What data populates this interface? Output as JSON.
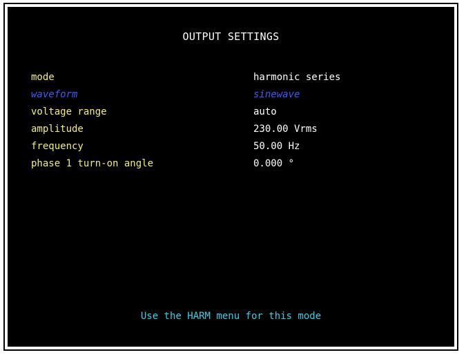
{
  "screen": {
    "title": "OUTPUT SETTINGS",
    "footer_hint": "Use the HARM menu for this mode"
  },
  "settings": [
    {
      "label": "mode",
      "value": "harmonic series",
      "selected": false
    },
    {
      "label": "waveform",
      "value": "sinewave",
      "selected": true
    },
    {
      "label": "voltage range",
      "value": "auto",
      "selected": false
    },
    {
      "label": "amplitude",
      "value": "230.00 Vrms",
      "selected": false
    },
    {
      "label": "frequency",
      "value": "50.00 Hz",
      "selected": false
    },
    {
      "label": "phase 1 turn-on angle",
      "value": "0.000 °",
      "selected": false
    }
  ],
  "colors": {
    "background": "#000000",
    "title": "#ffffff",
    "label_normal": "#f2f070",
    "label_selected": "#3a5cff",
    "footer": "#35d0e8"
  }
}
